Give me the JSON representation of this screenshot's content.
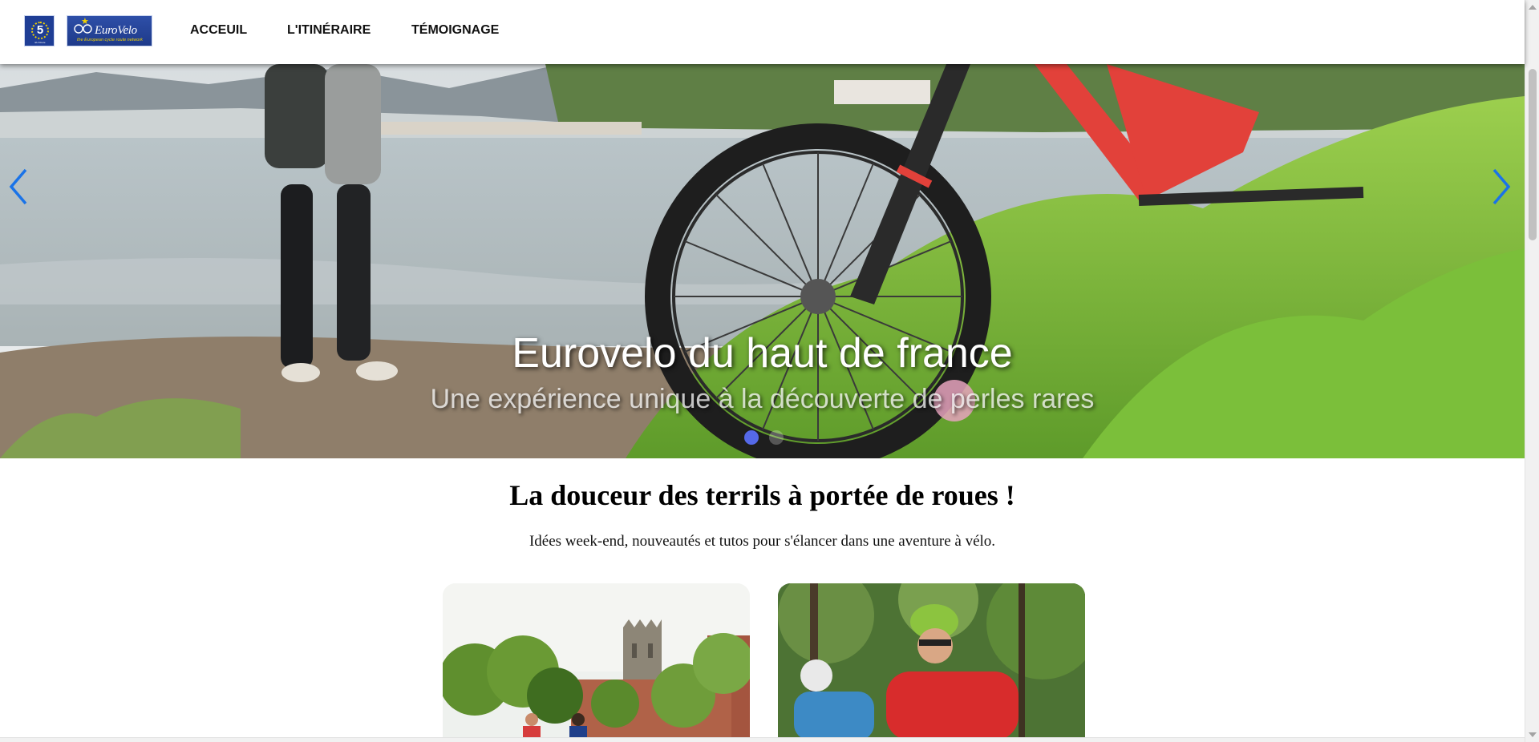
{
  "header": {
    "logos": {
      "eu_route": {
        "number": "5",
        "caption": "EU Route"
      },
      "eurovelo": {
        "brand": "EuroVelo",
        "tagline": "the European cycle route network"
      }
    },
    "nav": [
      {
        "label": "ACCEUIL"
      },
      {
        "label": "L'ITINÉRAIRE"
      },
      {
        "label": "TÉMOIGNAGE"
      }
    ]
  },
  "hero": {
    "title": "Eurovelo du haut de france",
    "subtitle": "Une expérience unique à la découverte de perles rares",
    "prev_icon": "chevron-left-icon",
    "next_icon": "chevron-right-icon",
    "slides_count": 2,
    "active_slide": 1,
    "accent_color": "#1a73e8",
    "dot_color": "#5569e8"
  },
  "intro": {
    "title": "La douceur des terrils à portée de roues !",
    "text": "Idées week-end, nouveautés et tutos pour s'élancer dans une aventure à vélo."
  },
  "cards": [
    {
      "image": "cathedral-cyclists-photo"
    },
    {
      "image": "forest-mountain-bikers-photo"
    }
  ]
}
